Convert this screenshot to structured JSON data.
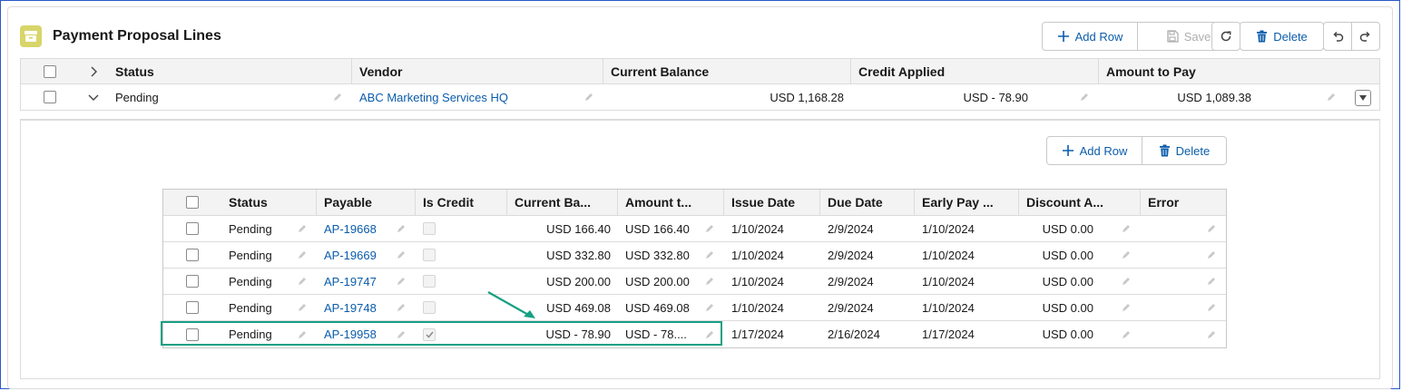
{
  "header": {
    "title": "Payment Proposal Lines",
    "icon": "archive-box-icon",
    "accent": "#d8d56a"
  },
  "toolbar": {
    "add_row_label": "Add Row",
    "save_label": "Save",
    "delete_label": "Delete"
  },
  "outer_grid": {
    "columns": [
      "Status",
      "Vendor",
      "Current Balance",
      "Credit Applied",
      "Amount to Pay"
    ],
    "row": {
      "status": "Pending",
      "vendor": "ABC Marketing Services HQ",
      "current_balance": "USD 1,168.28",
      "credit_applied": "USD - 78.90",
      "amount_to_pay": "USD 1,089.38"
    }
  },
  "inner_toolbar": {
    "add_row_label": "Add Row",
    "delete_label": "Delete"
  },
  "inner_grid": {
    "columns": [
      "Status",
      "Payable",
      "Is Credit",
      "Current Ba...",
      "Amount t...",
      "Issue Date",
      "Due Date",
      "Early Pay ...",
      "Discount A...",
      "Error"
    ],
    "rows": [
      {
        "status": "Pending",
        "payable": "AP-19668",
        "is_credit": false,
        "current_balance": "USD 166.40",
        "amount": "USD 166.40",
        "issue_date": "1/10/2024",
        "due_date": "2/9/2024",
        "early_pay": "1/10/2024",
        "discount": "USD 0.00",
        "error": ""
      },
      {
        "status": "Pending",
        "payable": "AP-19669",
        "is_credit": false,
        "current_balance": "USD 332.80",
        "amount": "USD 332.80",
        "issue_date": "1/10/2024",
        "due_date": "2/9/2024",
        "early_pay": "1/10/2024",
        "discount": "USD 0.00",
        "error": ""
      },
      {
        "status": "Pending",
        "payable": "AP-19747",
        "is_credit": false,
        "current_balance": "USD 200.00",
        "amount": "USD 200.00",
        "issue_date": "1/10/2024",
        "due_date": "2/9/2024",
        "early_pay": "1/10/2024",
        "discount": "USD 0.00",
        "error": ""
      },
      {
        "status": "Pending",
        "payable": "AP-19748",
        "is_credit": false,
        "current_balance": "USD 469.08",
        "amount": "USD 469.08",
        "issue_date": "1/10/2024",
        "due_date": "2/9/2024",
        "early_pay": "1/10/2024",
        "discount": "USD 0.00",
        "error": ""
      },
      {
        "status": "Pending",
        "payable": "AP-19958",
        "is_credit": true,
        "current_balance": "USD - 78.90",
        "amount": "USD - 78....",
        "issue_date": "1/17/2024",
        "due_date": "2/16/2024",
        "early_pay": "1/17/2024",
        "discount": "USD 0.00",
        "error": ""
      }
    ]
  },
  "annotation": {
    "highlight_color": "#17a083"
  },
  "colors": {
    "link": "#0b5cab",
    "header_bg": "#f3f3f3",
    "border": "#dddbda"
  }
}
